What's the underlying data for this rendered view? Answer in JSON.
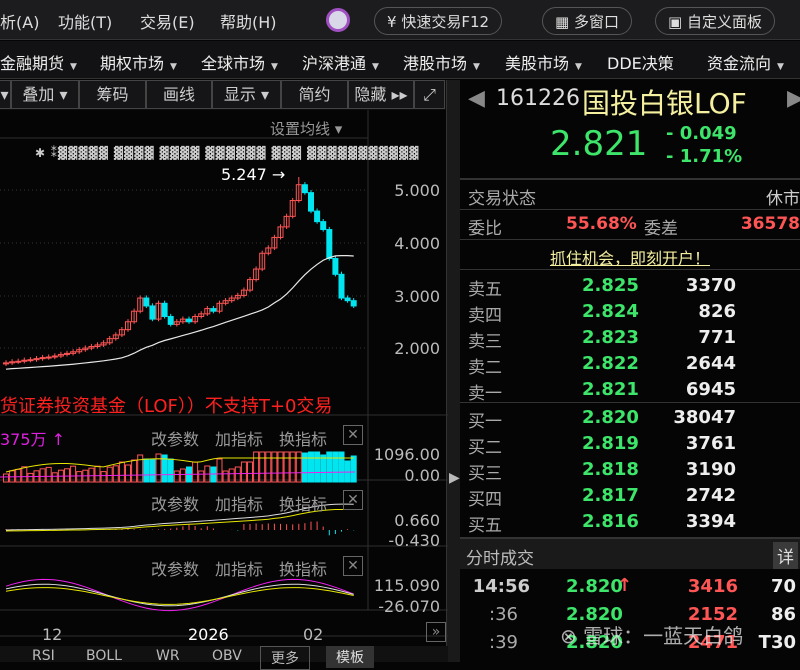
{
  "menubar": {
    "items": [
      "析(A)",
      "功能(T)",
      "交易(E)",
      "帮助(H)"
    ],
    "quick_trade": "快速交易F12",
    "multi_window": "多窗口",
    "custom_panel": "自定义面板"
  },
  "navbar": {
    "items": [
      "金融期货",
      "期权市场",
      "全球市场",
      "沪深港通",
      "港股市场",
      "美股市场",
      "DDE决策",
      "资金流向"
    ]
  },
  "toolbar": {
    "items": [
      "叠加",
      "筹码",
      "画线",
      "显示",
      "简约",
      "隐藏"
    ]
  },
  "chart": {
    "ma_setting": "设置均线",
    "peak_label": "5.247",
    "price_ticks": [
      "5.000",
      "4.000",
      "3.000",
      "2.000"
    ],
    "notice": "货证券投资基金（LOF））不支持T+0交易",
    "closes": [
      1.72,
      1.74,
      1.75,
      1.77,
      1.78,
      1.8,
      1.82,
      1.83,
      1.85,
      1.88,
      1.9,
      1.93,
      1.97,
      2.0,
      2.03,
      2.06,
      2.1,
      2.18,
      2.25,
      2.35,
      2.5,
      2.7,
      2.95,
      2.8,
      2.55,
      2.85,
      2.6,
      2.45,
      2.5,
      2.55,
      2.5,
      2.6,
      2.65,
      2.75,
      2.7,
      2.85,
      2.9,
      2.95,
      3.0,
      3.1,
      3.3,
      3.5,
      3.8,
      3.9,
      4.1,
      4.3,
      4.5,
      4.8,
      5.1,
      4.95,
      4.6,
      4.4,
      4.25,
      3.7,
      3.4,
      2.95,
      2.9,
      2.8
    ],
    "volume": {
      "label": "375万",
      "ticks": [
        "1096.00",
        "0.00"
      ]
    },
    "macd": {
      "ticks": [
        "0.660",
        "-0.430"
      ]
    },
    "cci": {
      "ticks": [
        "115.090",
        "-26.070"
      ]
    },
    "panel_actions": [
      "改参数",
      "加指标",
      "换指标"
    ],
    "x_ticks": [
      "12",
      "2026",
      "02"
    ],
    "indicator_tabs": [
      "RSI",
      "BOLL",
      "WR",
      "OBV",
      "更多",
      "模板"
    ]
  },
  "quote": {
    "code": "161226",
    "name": "国投白银LOF",
    "price": "2.821",
    "change": "- 0.049",
    "change_pct": "- 1.71%",
    "status_label": "交易状态",
    "status": "休市",
    "ratio_label": "委比",
    "ratio": "55.68%",
    "diff_label": "委差",
    "diff": "36578",
    "promo": "抓住机会，即刻开户！",
    "asks": [
      {
        "label": "卖五",
        "price": "2.825",
        "vol": "3370"
      },
      {
        "label": "卖四",
        "price": "2.824",
        "vol": "826"
      },
      {
        "label": "卖三",
        "price": "2.823",
        "vol": "771"
      },
      {
        "label": "卖二",
        "price": "2.822",
        "vol": "2644"
      },
      {
        "label": "卖一",
        "price": "2.821",
        "vol": "6945"
      }
    ],
    "bids": [
      {
        "label": "买一",
        "price": "2.820",
        "vol": "38047"
      },
      {
        "label": "买二",
        "price": "2.819",
        "vol": "3761"
      },
      {
        "label": "买三",
        "price": "2.818",
        "vol": "3190"
      },
      {
        "label": "买四",
        "price": "2.817",
        "vol": "2742"
      },
      {
        "label": "买五",
        "price": "2.816",
        "vol": "3394"
      }
    ],
    "ticks_title": "分时成交",
    "detail": "详",
    "ticks": [
      {
        "time": "14:56",
        "price": "2.820",
        "arrow": "↑",
        "vol": "3416",
        "n": "70"
      },
      {
        "time": ":36",
        "price": "2.820",
        "arrow": "",
        "vol": "2152",
        "n": "86"
      },
      {
        "time": ":39",
        "price": "2.820",
        "arrow": "",
        "vol": "2471",
        "n": "T30"
      }
    ],
    "watermark": "雪球：一蓝天白鸽"
  },
  "colors": {
    "up": "#ff5555",
    "down": "#00e5f0",
    "ma": "#e8e8e8",
    "yellow": "#e6e600",
    "magenta": "#ee22ee"
  }
}
